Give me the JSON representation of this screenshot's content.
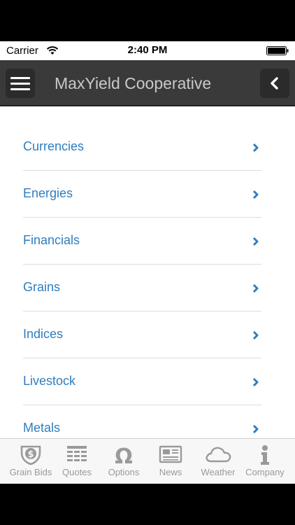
{
  "status_bar": {
    "carrier": "Carrier",
    "time": "2:40 PM"
  },
  "header": {
    "title": "MaxYield Cooperative"
  },
  "menu": {
    "items": [
      {
        "label": "Currencies"
      },
      {
        "label": "Energies"
      },
      {
        "label": "Financials"
      },
      {
        "label": "Grains"
      },
      {
        "label": "Indices"
      },
      {
        "label": "Livestock"
      },
      {
        "label": "Metals"
      }
    ]
  },
  "tabs": [
    {
      "label": "Grain Bids",
      "icon": "grain-bids-icon"
    },
    {
      "label": "Quotes",
      "icon": "quotes-icon"
    },
    {
      "label": "Options",
      "icon": "options-icon"
    },
    {
      "label": "News",
      "icon": "news-icon"
    },
    {
      "label": "Weather",
      "icon": "weather-icon"
    },
    {
      "label": "Company",
      "icon": "company-icon"
    }
  ],
  "colors": {
    "link": "#2f7ebf",
    "nav_bg": "#3a3a3a",
    "tab_icon": "#9a9a9a"
  }
}
